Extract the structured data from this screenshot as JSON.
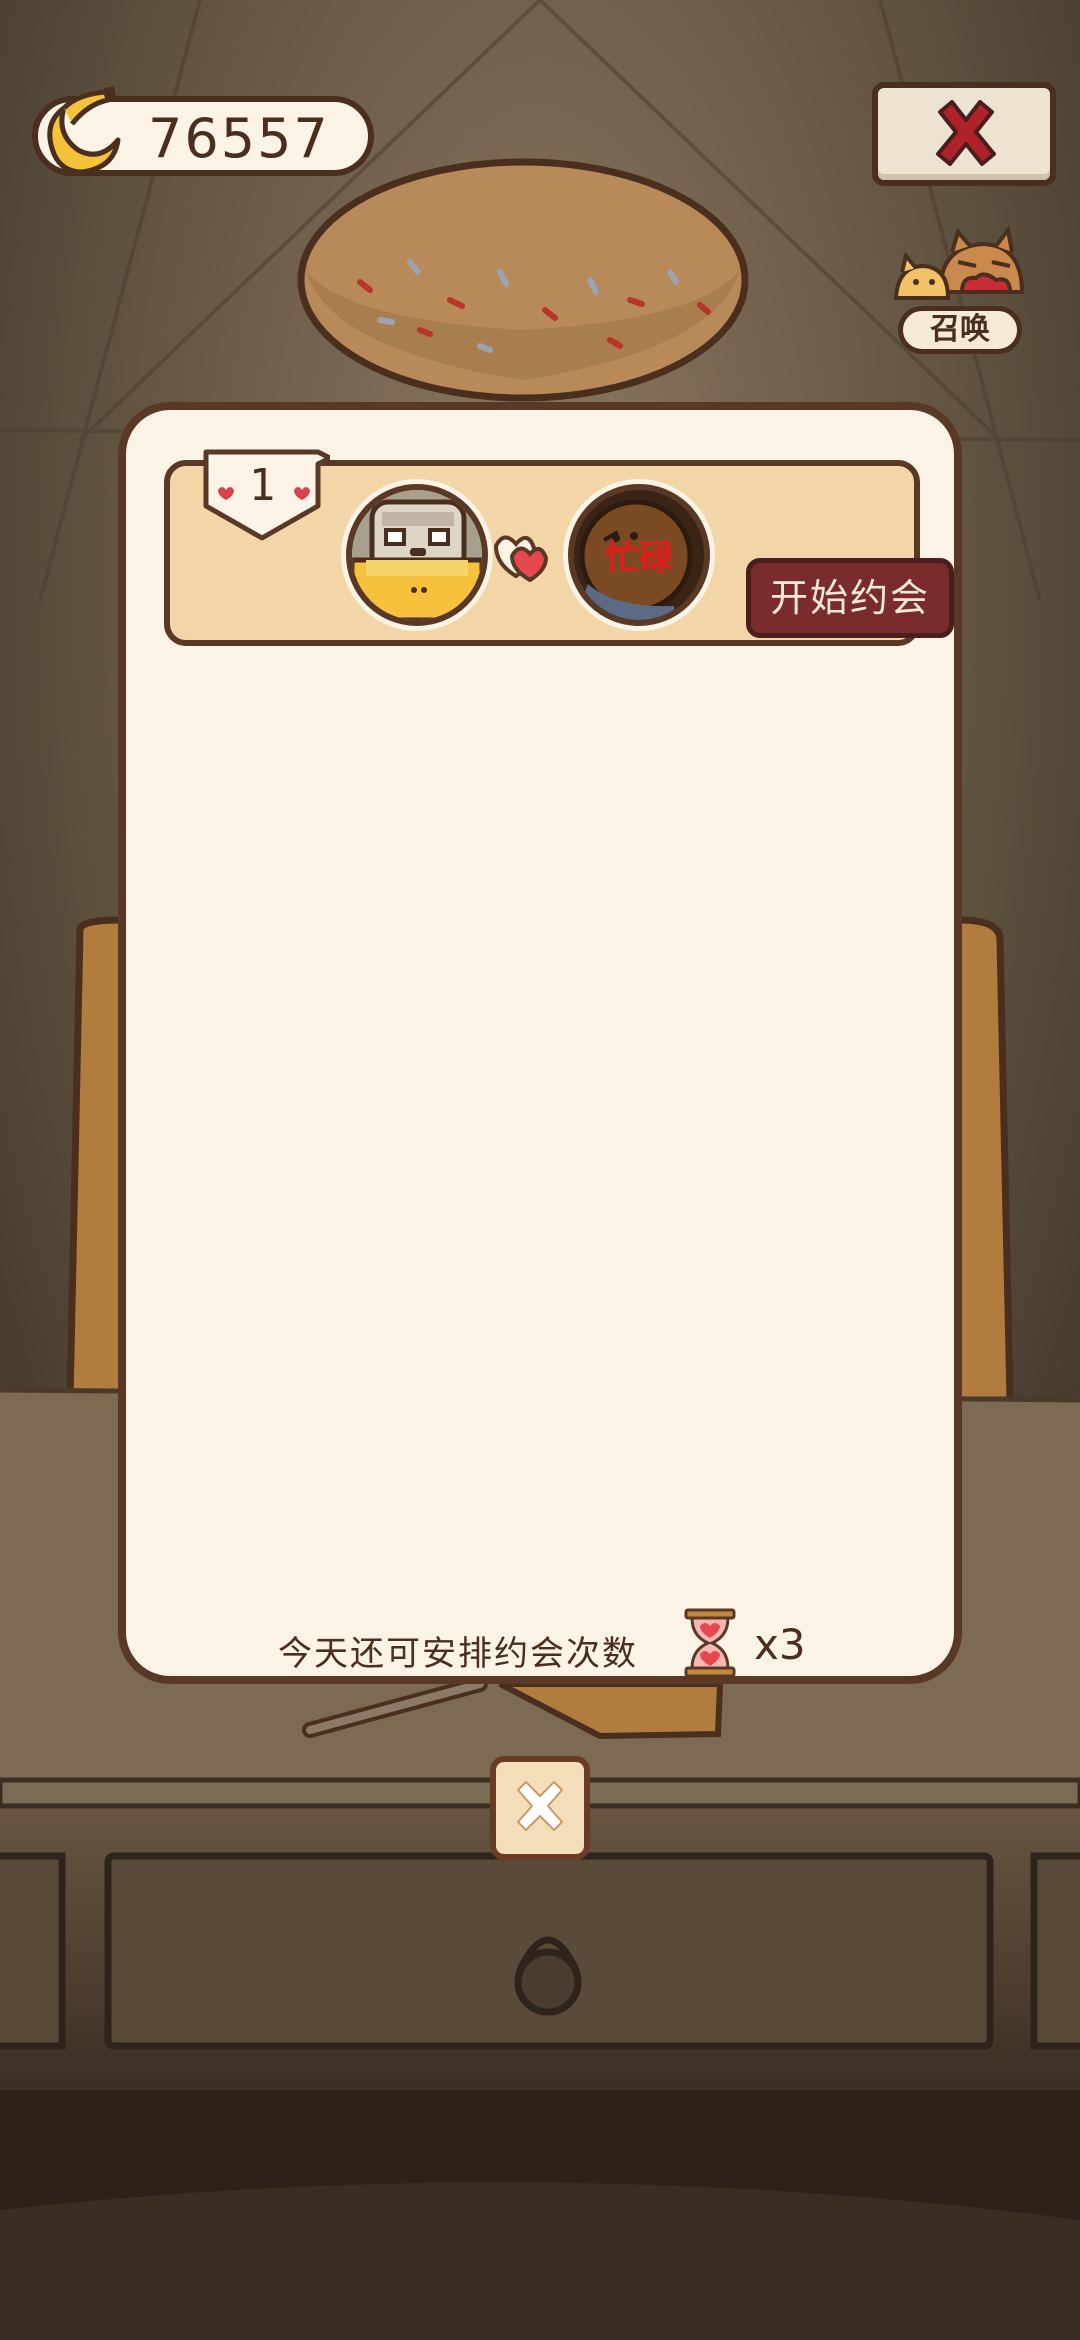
{
  "currency": {
    "icon": "banana-icon",
    "value": "76557"
  },
  "header": {
    "close_icon": "close-icon",
    "summon_label": "召唤"
  },
  "date_list": {
    "rows": [
      {
        "rank": "1",
        "left_avatar": "cat-avatar-yellow",
        "link_icon": "hearts-icon",
        "right_avatar": "cat-avatar-brown",
        "right_status": "忙碌",
        "start_label": "开始约会"
      }
    ]
  },
  "footer": {
    "remaining_text": "今天还可安排约会次数",
    "hourglass_icon": "hourglass-icon",
    "count": "x3"
  },
  "colors": {
    "panel_bg": "#fbf3e6",
    "border": "#5a3826",
    "button_red": "#7a2b2b",
    "busy_red": "#e21b1b",
    "row_bg": "#f3d6a8"
  }
}
